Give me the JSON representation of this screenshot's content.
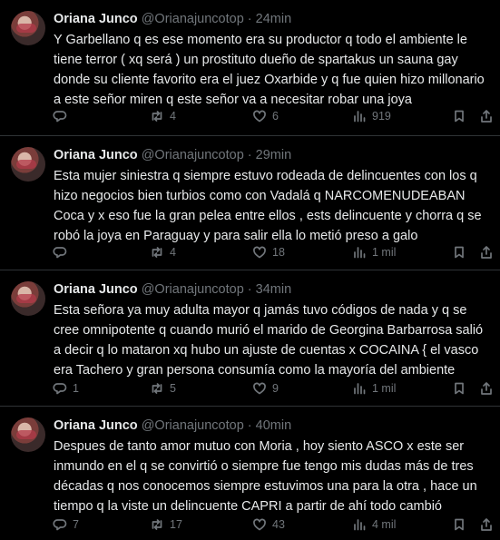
{
  "tweets": [
    {
      "name": "Oriana Junco",
      "handle": "@Orianajuncotop",
      "sep": "·",
      "time": "24min",
      "text": "Y Garbellano q es ese momento era su productor q todo el ambiente le tiene terror ( xq será ) un prostituto dueño de spartakus un sauna gay donde su cliente favorito era el juez Oxarbide y q fue quien hizo millonario a este señor miren q este señor va a necesitar robar una joya",
      "replies": "",
      "retweets": "4",
      "likes": "6",
      "views": "919"
    },
    {
      "name": "Oriana Junco",
      "handle": "@Orianajuncotop",
      "sep": "·",
      "time": "29min",
      "text": "Esta mujer siniestra q siempre estuvo rodeada de delincuentes con los q hizo negocios bien turbios como con Vadalá q NARCOMENUDEABAN Coca y x eso fue la gran pelea entre ellos , ests delincuente y chorra q se robó la joya en Paraguay y para salir ella lo metió preso a galo",
      "replies": "",
      "retweets": "4",
      "likes": "18",
      "views": "1 mil"
    },
    {
      "name": "Oriana Junco",
      "handle": "@Orianajuncotop",
      "sep": "·",
      "time": "34min",
      "text": "Esta señora ya muy adulta mayor q jamás tuvo códigos de nada y q se cree omnipotente q cuando murió el marido de Georgina Barbarrosa salió a decir q lo mataron xq hubo un ajuste de cuentas x COCAINA { el vasco era Tachero y gran persona consumía como la mayoría del ambiente",
      "replies": "1",
      "retweets": "5",
      "likes": "9",
      "views": "1 mil"
    },
    {
      "name": "Oriana Junco",
      "handle": "@Orianajuncotop",
      "sep": "·",
      "time": "40min",
      "text": "Despues de tanto amor mutuo con Moria , hoy siento ASCO x este ser inmundo en el q se convirtió o siempre fue tengo mis dudas más de tres décadas q nos conocemos siempre estuvimos una para la otra , hace un tiempo q la viste un delincuente CAPRI a partir de ahí todo cambió",
      "replies": "7",
      "retweets": "17",
      "likes": "43",
      "views": "4 mil"
    }
  ],
  "icons": {
    "reply": "reply-icon",
    "retweet": "retweet-icon",
    "like": "heart-icon",
    "views": "views-chart-icon",
    "bookmark": "bookmark-icon",
    "share": "share-icon"
  },
  "colors": {
    "background": "#000000",
    "text": "#e7e9ea",
    "muted": "#71767b",
    "divider": "#2f3336"
  }
}
